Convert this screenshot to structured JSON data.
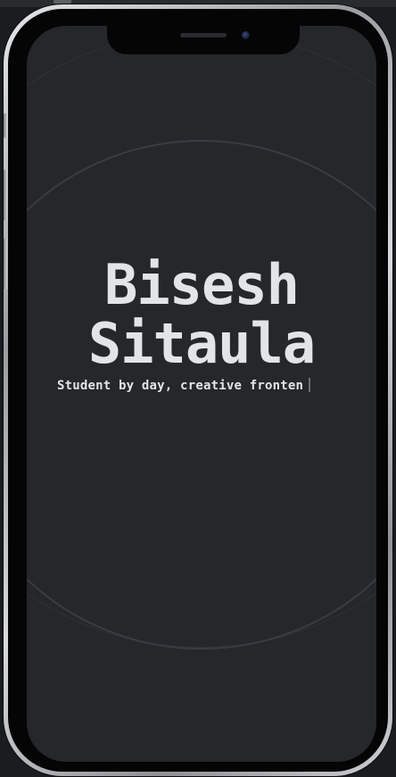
{
  "hero": {
    "first_name": "Bisesh",
    "last_name": "Sitaula"
  },
  "tagline": {
    "text": "Student by day, creative fronten"
  },
  "colors": {
    "screen_background": "#25272b",
    "text": "#e3e4e7",
    "circle_stroke": "#3a3c41",
    "device_frame": "#d8d9dc"
  }
}
